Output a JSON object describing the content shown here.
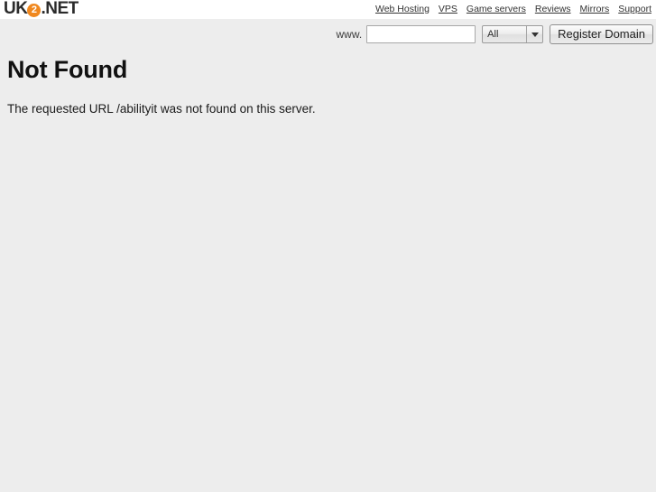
{
  "brand": {
    "prefix": "UK",
    "badge": "2",
    "suffix": ".NET",
    "badge_color": "#f0881f"
  },
  "topnav": {
    "items": [
      {
        "label": "Web Hosting"
      },
      {
        "label": "VPS"
      },
      {
        "label": "Game servers"
      },
      {
        "label": "Reviews"
      },
      {
        "label": "Mirrors"
      },
      {
        "label": "Support"
      }
    ]
  },
  "domain_search": {
    "www_label": "www.",
    "input_value": "",
    "input_placeholder": "",
    "tld_selected": "All",
    "tld_options": [
      "All"
    ],
    "register_label": "Register Domain"
  },
  "main": {
    "title": "Not Found",
    "message": "The requested URL /abilityit was not found on this server."
  },
  "colors": {
    "page_background": "#ededed",
    "header_background": "#ffffff",
    "accent": "#f0881f",
    "text": "#111111"
  }
}
